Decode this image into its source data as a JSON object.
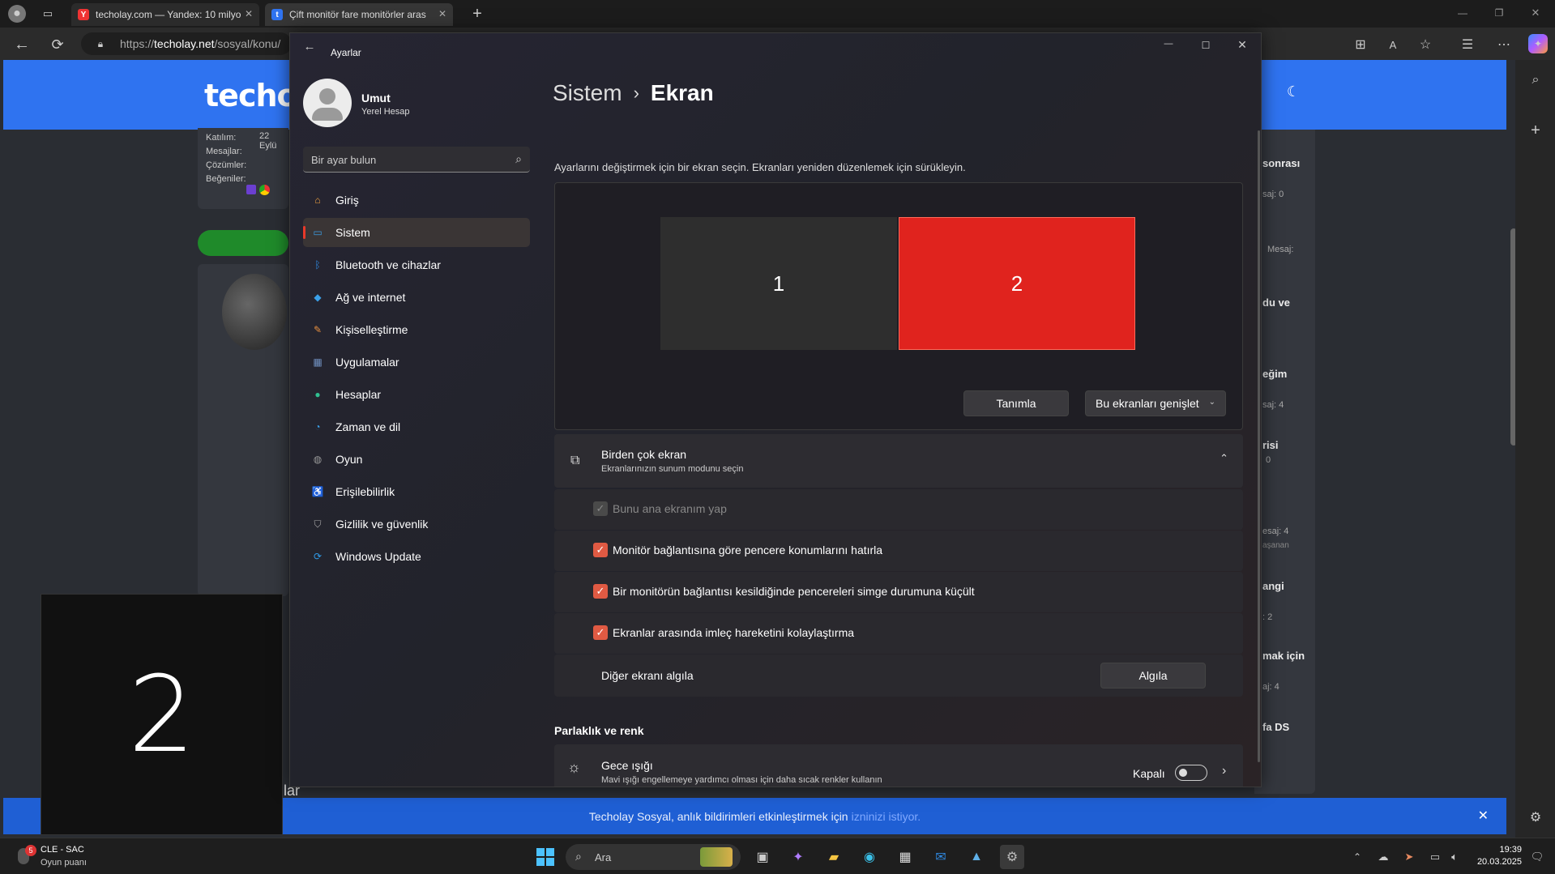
{
  "browser": {
    "tabs": [
      {
        "title": "techolay.com — Yandex: 10 milyo",
        "favicon": "Y",
        "color": "#e33"
      },
      {
        "title": "Çift monitör fare monitörler aras",
        "favicon": "t",
        "color": "#2f73f0"
      }
    ],
    "url_prefix": "https://",
    "url_host": "techolay.net",
    "url_path": "/sosyal/konu/"
  },
  "site": {
    "logo": "techo",
    "left_profile": {
      "rows": [
        "Katılım:",
        "Mesajlar:",
        "Çözümler:",
        "Beğeniler:"
      ],
      "joined": "22 Eylü"
    },
    "right_snippets": [
      "sonrası",
      "saj: 0",
      "Mesaj:",
      "du ve",
      "eğim",
      "saj: 4",
      "risi",
      "0",
      "esaj: 4",
      "aşanan",
      "angi",
      ": 2",
      "mak için",
      "aj: 4",
      "fa DS"
    ],
    "bottom_word": "ular",
    "notification": {
      "text": "Techolay Sosyal, anlık bildirimleri etkinleştirmek için",
      "link": "izninizi istiyor."
    }
  },
  "overlay_number": "2",
  "settings": {
    "app_title": "Ayarlar",
    "user": {
      "name": "Umut",
      "account": "Yerel Hesap"
    },
    "search_placeholder": "Bir ayar bulun",
    "nav": [
      {
        "label": "Giriş",
        "icon": "home-icon",
        "color": "#f0a040",
        "glyph": "⌂"
      },
      {
        "label": "Sistem",
        "icon": "system-icon",
        "color": "#3a9be0",
        "glyph": "▭"
      },
      {
        "label": "Bluetooth ve cihazlar",
        "icon": "bluetooth-icon",
        "color": "#2f88e0",
        "glyph": "ᛒ"
      },
      {
        "label": "Ağ ve internet",
        "icon": "network-icon",
        "color": "#3aa0e8",
        "glyph": "◆"
      },
      {
        "label": "Kişiselleştirme",
        "icon": "brush-icon",
        "color": "#e89040",
        "glyph": "✎"
      },
      {
        "label": "Uygulamalar",
        "icon": "apps-icon",
        "color": "#7090c0",
        "glyph": "▦"
      },
      {
        "label": "Hesaplar",
        "icon": "accounts-icon",
        "color": "#30c090",
        "glyph": "●"
      },
      {
        "label": "Zaman ve dil",
        "icon": "clock-globe-icon",
        "color": "#3aa0e8",
        "glyph": "◔"
      },
      {
        "label": "Oyun",
        "icon": "gamepad-icon",
        "color": "#999999",
        "glyph": "◍"
      },
      {
        "label": "Erişilebilirlik",
        "icon": "accessibility-icon",
        "color": "#3aa0e8",
        "glyph": "♿"
      },
      {
        "label": "Gizlilik ve güvenlik",
        "icon": "shield-icon",
        "color": "#aaaaaa",
        "glyph": "⛉"
      },
      {
        "label": "Windows Update",
        "icon": "update-icon",
        "color": "#2f9be8",
        "glyph": "⟳"
      }
    ],
    "selected_nav_index": 1,
    "breadcrumb": {
      "parent": "Sistem",
      "sep": "›",
      "current": "Ekran"
    },
    "instruction": "Ayarlarını değiştirmek için bir ekran seçin. Ekranları yeniden düzenlemek için sürükleyin.",
    "monitors": [
      {
        "label": "1",
        "color": "#2e2e2e"
      },
      {
        "label": "2",
        "color": "#e0231e"
      }
    ],
    "identify_button": "Tanımla",
    "mode_select": "Bu ekranları genişlet",
    "multi": {
      "title": "Birden çok ekran",
      "subtitle": "Ekranlarınızın sunum modunu seçin",
      "options": [
        {
          "label": "Bunu ana ekranım yap",
          "checked": true,
          "disabled": true
        },
        {
          "label": "Monitör bağlantısına göre pencere konumlarını hatırla",
          "checked": true,
          "disabled": false
        },
        {
          "label": "Bir monitörün bağlantısı kesildiğinde pencereleri simge durumuna küçült",
          "checked": true,
          "disabled": false
        },
        {
          "label": "Ekranlar arasında imleç hareketini kolaylaştırma",
          "checked": true,
          "disabled": false
        }
      ],
      "detect_label": "Diğer ekranı algıla",
      "detect_button": "Algıla"
    },
    "brightness_section": "Parlaklık ve renk",
    "night_light": {
      "title": "Gece ışığı",
      "subtitle": "Mavi ışığı engellemeye yardımcı olması için daha sıcak renkler kullanın",
      "state": "Kapalı"
    }
  },
  "taskbar": {
    "weather": {
      "title": "CLE - SAC",
      "subtitle": "Oyun puanı",
      "badge": "5"
    },
    "search_label": "Ara",
    "time": "19:39",
    "date": "20.03.2025"
  }
}
